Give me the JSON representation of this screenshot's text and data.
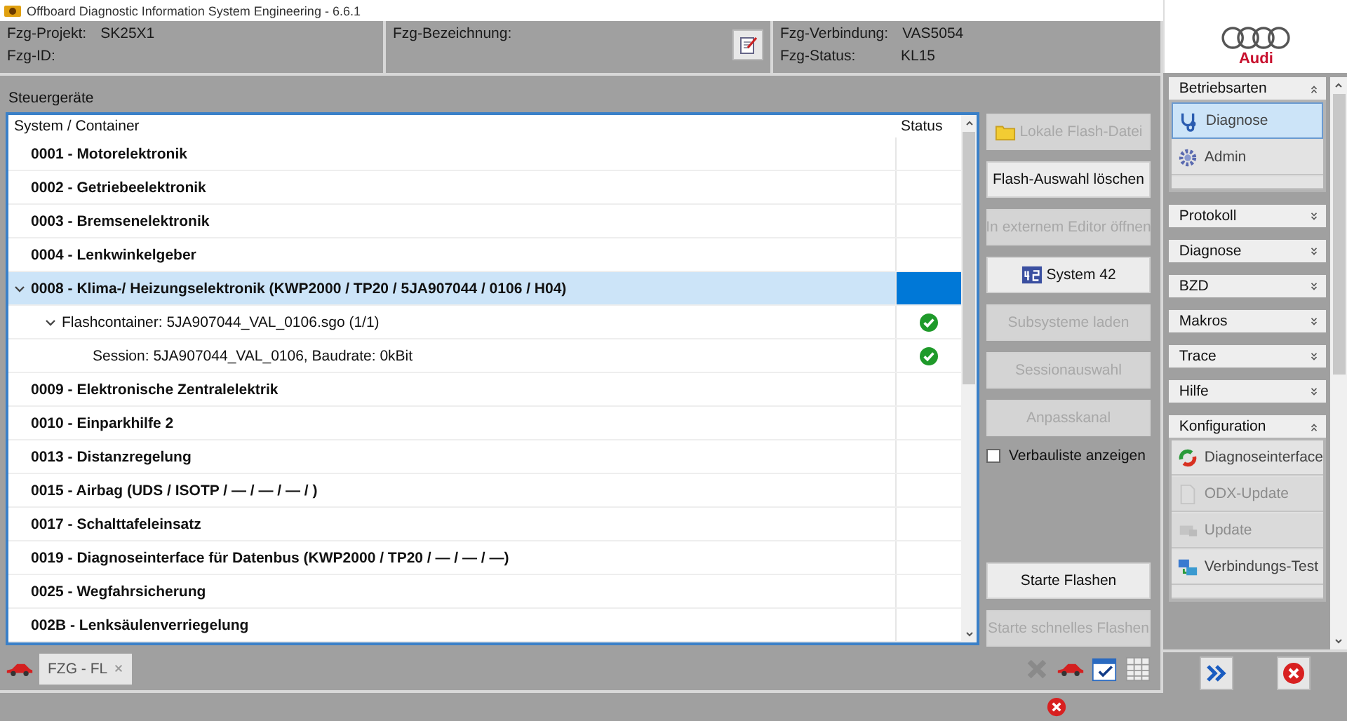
{
  "window": {
    "title": "Offboard Diagnostic Information System Engineering - 6.6.1"
  },
  "vehicle": {
    "projekt_label": "Fzg-Projekt:",
    "projekt": "SK25X1",
    "id_label": "Fzg-ID:",
    "bezeichnung_label": "Fzg-Bezeichnung:",
    "verbindung_label": "Fzg-Verbindung:",
    "verbindung": "VAS5054",
    "status_label": "Fzg-Status:",
    "status": "KL15"
  },
  "logo": {
    "text": "Audi"
  },
  "section_title": "Steuergeräte",
  "table": {
    "columns": [
      "System / Container",
      "Status"
    ],
    "rows": [
      {
        "name": "0001 - Motorelektronik",
        "selected": false
      },
      {
        "name": "0002 - Getriebeelektronik",
        "selected": false
      },
      {
        "name": "0003 - Bremsenelektronik",
        "selected": false
      },
      {
        "name": "0004 - Lenkwinkelgeber",
        "selected": false
      },
      {
        "name": "0008 - Klima-/ Heizungselektronik  (KWP2000 / TP20 / 5JA907044 / 0106 / H04)",
        "selected": true,
        "expanded": true,
        "children": [
          {
            "name": "Flashcontainer: 5JA907044_VAL_0106.sgo (1/1)",
            "selected": false,
            "kind": "checked",
            "expanded": true,
            "children": [
              {
                "name": "Session: 5JA907044_VAL_0106, Baudrate: 0kBit",
                "selected": false,
                "kind": "checked"
              }
            ]
          }
        ]
      },
      {
        "name": "0009 - Elektronische Zentralelektrik",
        "selected": false
      },
      {
        "name": "0010 - Einparkhilfe 2",
        "selected": false
      },
      {
        "name": "0013 - Distanzregelung",
        "selected": false
      },
      {
        "name": "0015 - Airbag  (UDS / ISOTP / — / — / — /  )",
        "selected": false
      },
      {
        "name": "0017 - Schalttafeleinsatz",
        "selected": false
      },
      {
        "name": "0019 - Diagnoseinterface für Datenbus  (KWP2000 / TP20 / — / — / —)",
        "selected": false
      },
      {
        "name": "0025 - Wegfahrsicherung",
        "selected": false
      },
      {
        "name": "002B - Lenksäulenverriegelung",
        "selected": false
      }
    ]
  },
  "actions": [
    {
      "label": "Lokale Flash-Datei",
      "disabled": true,
      "kind": "folder"
    },
    {
      "label": "Flash-Auswahl löschen",
      "disabled": false
    },
    {
      "label": "In externem Editor öffnen",
      "disabled": true
    },
    {
      "label": "System 42",
      "disabled": false,
      "kind": "system"
    },
    {
      "label": "Subsysteme laden",
      "disabled": true
    },
    {
      "label": "Sessionauswahl",
      "disabled": true
    },
    {
      "label": "Anpasskanal",
      "disabled": true
    }
  ],
  "verbauliste": {
    "label": "Verbauliste anzeigen",
    "checked": false
  },
  "flash_actions": [
    {
      "label": "Starte Flashen",
      "disabled": false
    },
    {
      "label": "Starte schnelles Flashen",
      "disabled": true
    }
  ],
  "tabs": [
    {
      "label": "FZG - FL",
      "selected": true
    }
  ],
  "sidebar": [
    {
      "title": "Betriebsarten",
      "expanded": true,
      "items": [
        {
          "label": "Diagnose",
          "kind": "stethoscope",
          "selected": true,
          "disabled": false
        },
        {
          "label": "Admin",
          "kind": "gear",
          "selected": false,
          "disabled": false
        }
      ]
    },
    {
      "title": "Protokoll",
      "expanded": false
    },
    {
      "title": "Diagnose",
      "expanded": false
    },
    {
      "title": "BZD",
      "expanded": false
    },
    {
      "title": "Makros",
      "expanded": false
    },
    {
      "title": "Trace",
      "expanded": false
    },
    {
      "title": "Hilfe",
      "expanded": false
    },
    {
      "title": "Konfiguration",
      "expanded": true,
      "items": [
        {
          "label": "Diagnoseinterface",
          "kind": "interface",
          "selected": false,
          "disabled": false
        },
        {
          "label": "ODX-Update",
          "kind": "document",
          "selected": false,
          "disabled": true
        },
        {
          "label": "Update",
          "kind": "update",
          "selected": false,
          "disabled": true
        },
        {
          "label": "Verbindungs-Test",
          "kind": "network",
          "selected": false,
          "disabled": false
        }
      ]
    }
  ]
}
